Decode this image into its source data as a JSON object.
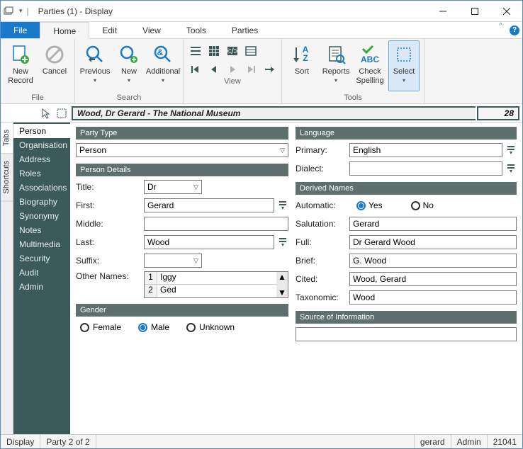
{
  "window": {
    "title": "Parties (1) - Display"
  },
  "ribbon_tabs": {
    "file": "File",
    "home": "Home",
    "edit": "Edit",
    "view": "View",
    "tools": "Tools",
    "parties": "Parties"
  },
  "ribbon": {
    "file_grp": {
      "label": "File",
      "new_record": "New\nRecord",
      "cancel": "Cancel"
    },
    "search_grp": {
      "label": "Search",
      "previous": "Previous",
      "new": "New",
      "additional": "Additional"
    },
    "view_grp": {
      "label": "View"
    },
    "tools_grp": {
      "label": "Tools",
      "sort": "Sort",
      "reports": "Reports",
      "check": "Check\nSpelling",
      "select": "Select"
    }
  },
  "record_bar": {
    "title": "Wood, Dr Gerard - The National Museum",
    "num": "28"
  },
  "side_tabs": {
    "tabs": "Tabs",
    "shortcuts": "Shortcuts"
  },
  "nav": {
    "items": [
      "Person",
      "Organisation",
      "Address",
      "Roles",
      "Associations",
      "Biography",
      "Synonymy",
      "Notes",
      "Multimedia",
      "Security",
      "Audit",
      "Admin"
    ]
  },
  "form": {
    "party_type": {
      "head": "Party Type",
      "value": "Person"
    },
    "person": {
      "head": "Person Details",
      "title_lbl": "Title:",
      "title": "Dr",
      "first_lbl": "First:",
      "first": "Gerard",
      "middle_lbl": "Middle:",
      "middle": "",
      "last_lbl": "Last:",
      "last": "Wood",
      "suffix_lbl": "Suffix:",
      "suffix": "",
      "other_lbl": "Other Names:",
      "other": [
        {
          "n": "1",
          "v": "Iggy"
        },
        {
          "n": "2",
          "v": "Ged"
        }
      ]
    },
    "gender": {
      "head": "Gender",
      "female": "Female",
      "male": "Male",
      "unknown": "Unknown",
      "value": "Male"
    },
    "language": {
      "head": "Language",
      "primary_lbl": "Primary:",
      "primary": "English",
      "dialect_lbl": "Dialect:",
      "dialect": ""
    },
    "derived": {
      "head": "Derived Names",
      "auto_lbl": "Automatic:",
      "yes": "Yes",
      "no": "No",
      "sal_lbl": "Salutation:",
      "sal": "Gerard",
      "full_lbl": "Full:",
      "full": "Dr Gerard Wood",
      "brief_lbl": "Brief:",
      "brief": "G. Wood",
      "cited_lbl": "Cited:",
      "cited": "Wood, Gerard",
      "tax_lbl": "Taxonomic:",
      "tax": "Wood"
    },
    "source": {
      "head": "Source of Information",
      "value": ""
    }
  },
  "status": {
    "mode": "Display",
    "pos": "Party 2 of 2",
    "user": "gerard",
    "role": "Admin",
    "ver": "21041"
  }
}
